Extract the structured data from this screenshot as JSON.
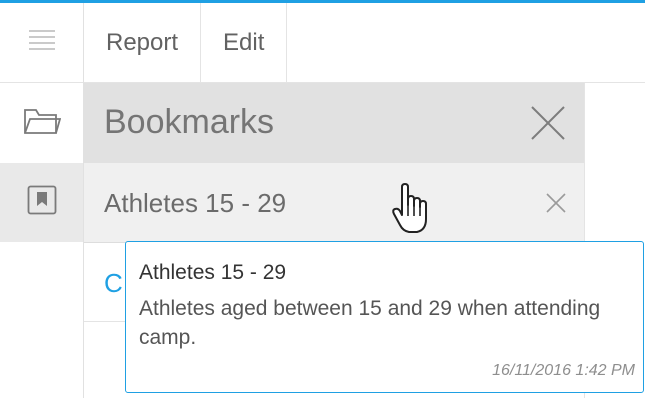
{
  "toolbar": {
    "items": [
      {
        "label": "Report"
      },
      {
        "label": "Edit"
      }
    ]
  },
  "rail": {
    "icons": [
      "menu-icon",
      "folder-icon",
      "bookmark-icon"
    ]
  },
  "panel": {
    "title": "Bookmarks",
    "bookmarks": [
      {
        "label": "Athletes 15 - 29"
      }
    ],
    "next_row_partial": "C"
  },
  "tooltip": {
    "title": "Athletes 15 - 29",
    "description": "Athletes aged between 15 and 29 when attending camp.",
    "timestamp": "16/11/2016 1:42 PM"
  },
  "colors": {
    "accent": "#1fa0e3",
    "header_bg": "#e1e1e1",
    "selected_row_bg": "#f0f0f0",
    "rail_active_bg": "#e9e9e9"
  }
}
